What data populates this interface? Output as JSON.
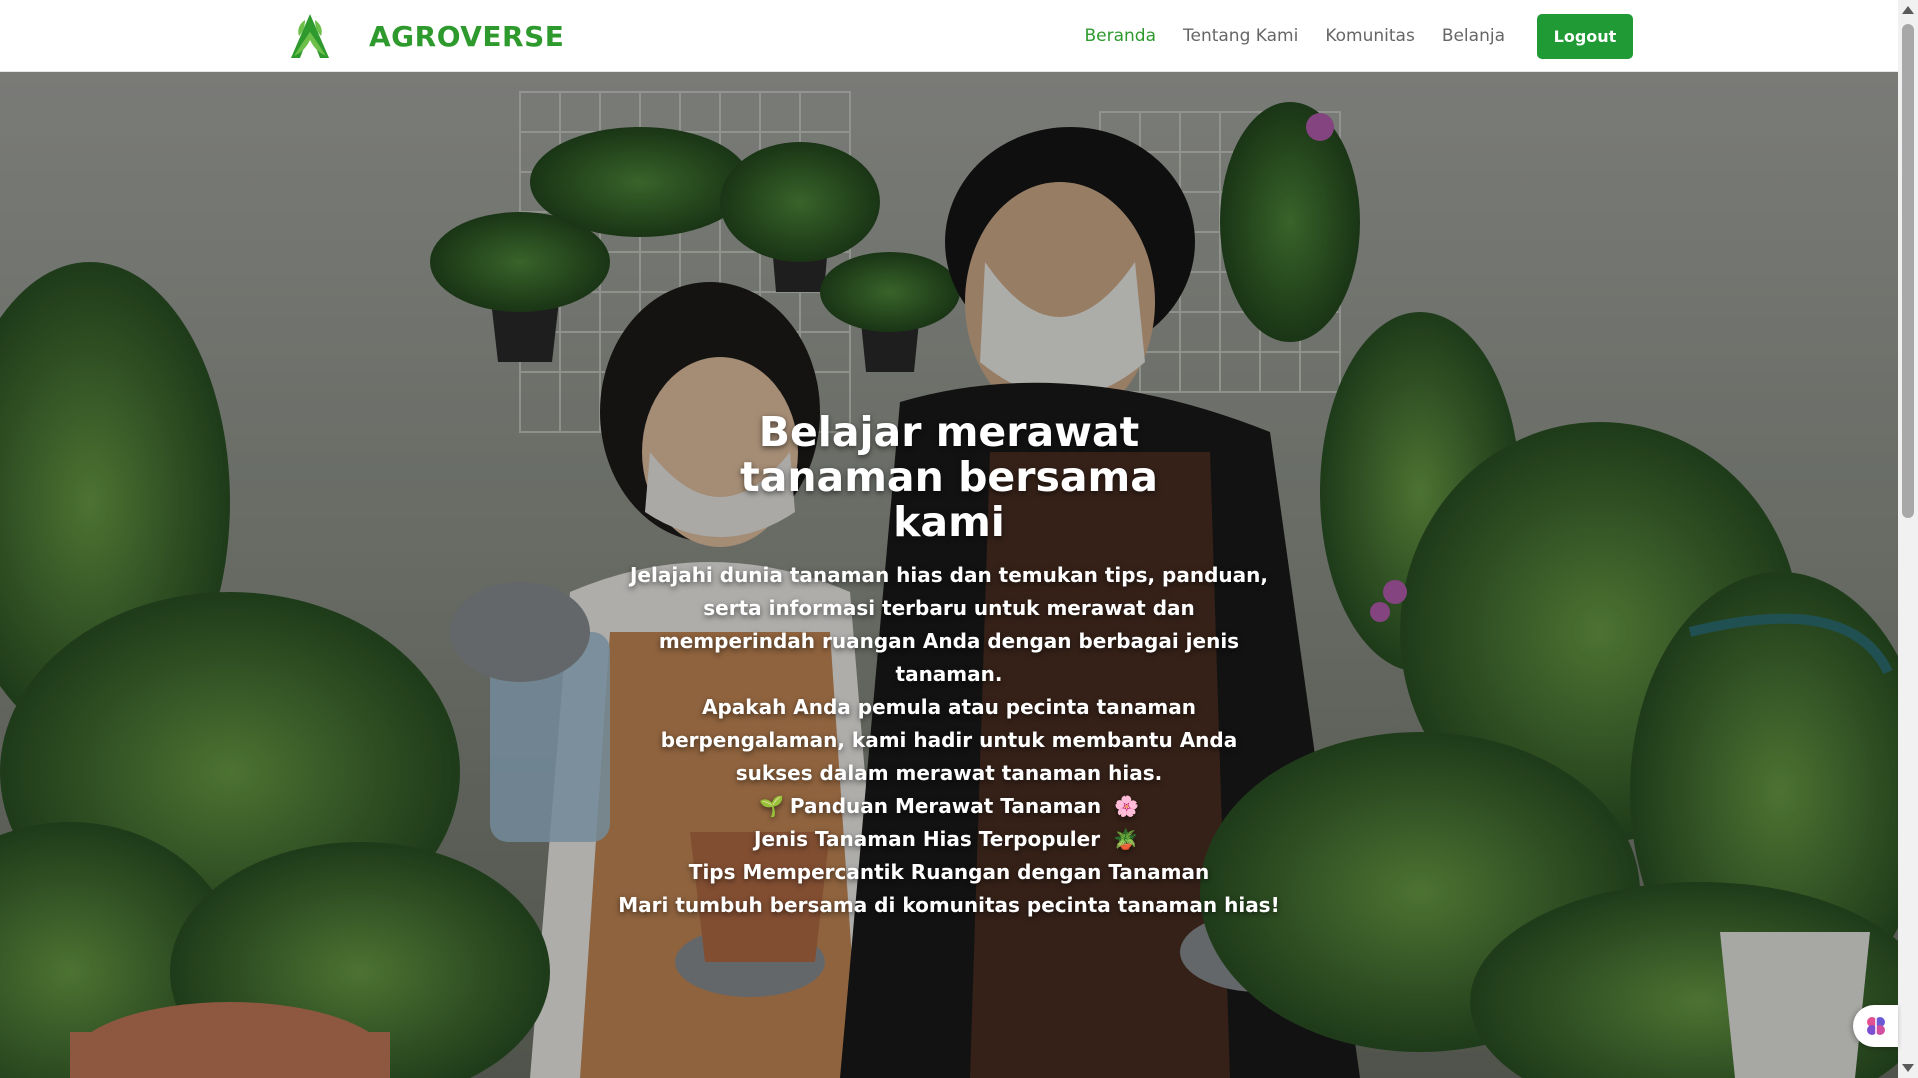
{
  "brand": {
    "name": "AGROVERSE",
    "logo_icon": "leaf-a-logo-icon",
    "color": "#2e9a2e"
  },
  "nav": {
    "items": [
      {
        "label": "Beranda",
        "active": true
      },
      {
        "label": "Tentang Kami",
        "active": false
      },
      {
        "label": "Komunitas",
        "active": false
      },
      {
        "label": "Belanja",
        "active": false
      }
    ],
    "logout_label": "Logout",
    "logout_color": "#1f9a35"
  },
  "hero": {
    "title": "Belajar merawat tanaman bersama kami",
    "desc1": "Jelajahi dunia tanaman hias dan temukan tips, panduan, serta informasi terbaru untuk merawat dan memperindah ruangan Anda dengan berbagai jenis tanaman.",
    "desc2": "Apakah Anda pemula atau pecinta tanaman berpengalaman, kami hadir untuk membantu Anda sukses dalam merawat tanaman hias.",
    "list": [
      {
        "icon": "🌱",
        "text": "Panduan Merawat Tanaman"
      },
      {
        "icon": "🌸",
        "text": "Jenis Tanaman Hias Terpopuler"
      },
      {
        "icon": "🪴",
        "text": "Tips Mempercantik Ruangan dengan Tanaman"
      }
    ],
    "closing": "Mari tumbuh bersama di komunitas pecinta tanaman hias!"
  },
  "assistant": {
    "icon": "brain-icon"
  }
}
